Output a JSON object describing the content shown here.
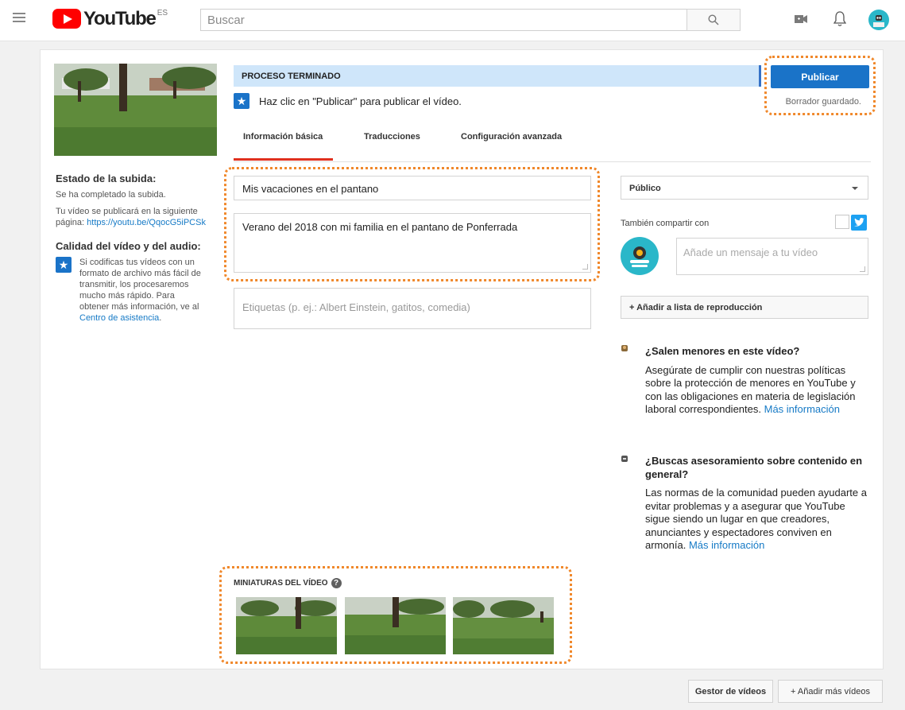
{
  "header": {
    "logo_text": "YouTube",
    "logo_country": "ES",
    "search_placeholder": "Buscar"
  },
  "sidebar": {
    "upload_status_title": "Estado de la subida:",
    "upload_complete": "Se ha completado la subida.",
    "publish_page_text": "Tu vídeo se publicará en la siguiente página:",
    "publish_link": "https://youtu.be/QqocG5iPCSk",
    "quality_title": "Calidad del vídeo y del audio:",
    "quality_text": "Si codificas tus vídeos con un formato de archivo más fácil de transmitir, los procesaremos mucho más rápido. Para obtener más información, ve al",
    "help_center_link": "Centro de asistencia",
    "quality_text_end": "."
  },
  "status": {
    "banner": "PROCESO TERMINADO",
    "message": "Haz clic en \"Publicar\" para publicar el vídeo.",
    "publish_button": "Publicar",
    "draft_saved": "Borrador guardado."
  },
  "tabs": [
    {
      "label": "Información básica",
      "active": true
    },
    {
      "label": "Traducciones",
      "active": false
    },
    {
      "label": "Configuración avanzada",
      "active": false
    }
  ],
  "form": {
    "title_value": "Mis vacaciones en el pantano",
    "description_value": "Verano del 2018 con mi familia en el pantano de Ponferrada",
    "tags_placeholder": "Etiquetas (p. ej.: Albert Einstein, gatitos, comedia)"
  },
  "right_panel": {
    "privacy_value": "Público",
    "share_label": "También compartir con",
    "share_message_placeholder": "Añade un mensaje a tu vídeo",
    "playlist_button": "+ Añadir a lista de reproducción"
  },
  "info": {
    "minors_title": "¿Salen menores en este vídeo?",
    "minors_text": "Asegúrate de cumplir con nuestras políticas sobre la protección de menores en YouTube y con las obligaciones en materia de legislación laboral correspondientes.",
    "minors_link": "Más información",
    "advice_title": "¿Buscas asesoramiento sobre contenido en general?",
    "advice_text": "Las normas de la comunidad pueden ayudarte a evitar problemas y a asegurar que YouTube sigue siendo un lugar en que creadores, anunciantes y espectadores conviven en armonía.",
    "advice_link": "Más información"
  },
  "thumbnails": {
    "label": "MINIATURAS DEL VÍDEO",
    "help": "?"
  },
  "footer": {
    "video_manager": "Gestor de vídeos",
    "add_more": "+ Añadir más vídeos"
  },
  "colors": {
    "accent_blue": "#1a73c8",
    "youtube_red": "#ff0000",
    "highlight_orange": "#f0882b",
    "tab_underline": "#e0301e"
  }
}
